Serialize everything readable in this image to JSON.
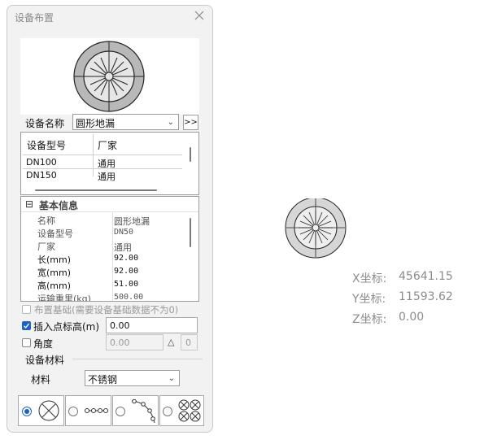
{
  "dialog": {
    "title": "设备布置",
    "equipment_name_label": "设备名称",
    "equipment_name_value": "圆形地漏",
    "more_button": ">>",
    "list": {
      "headers": [
        "设备型号",
        "厂家"
      ],
      "rows": [
        [
          "DN100",
          "通用"
        ],
        [
          "DN150",
          "通用"
        ]
      ]
    },
    "props": {
      "section_toggle": "⊟",
      "section_title": "基本信息",
      "rows": [
        {
          "name": "名称",
          "value": "圆形地漏"
        },
        {
          "name": "设备型号",
          "value": "DN50"
        },
        {
          "name": "厂家",
          "value": "通用"
        },
        {
          "name": "长(mm)",
          "value": "92.00"
        },
        {
          "name": "宽(mm)",
          "value": "92.00"
        },
        {
          "name": "高(mm)",
          "value": "51.00"
        },
        {
          "name": "运输重里(kg)",
          "value": "500.00"
        }
      ]
    },
    "foundation_label": "布置基础(需要设备基础数据不为0)",
    "insert_height_label": "插入点标高(m)",
    "insert_height_value": "0.00",
    "angle_label": "角度",
    "angle_value": "0.00",
    "angle_symbol": "△",
    "angle_step": "0",
    "material_group_title": "设备材料",
    "material_label": "材料",
    "material_value": "不锈钢",
    "layout_options": [
      "single",
      "line",
      "arc",
      "matrix"
    ],
    "selected_option": "single"
  },
  "coords": {
    "x_label": "X坐标:",
    "x_value": "45641.15",
    "y_label": "Y坐标:",
    "y_value": "11593.62",
    "z_label": "Z坐标:",
    "z_value": "0.00"
  },
  "colors": {
    "accent": "#1e62c8",
    "drain_outer": "#b8b8b8",
    "drain_inner": "#e6e6e6"
  },
  "icons": {
    "close": "close-icon",
    "dropdown": "chevron-down-icon",
    "drain": "floor-drain-symbol-icon"
  }
}
